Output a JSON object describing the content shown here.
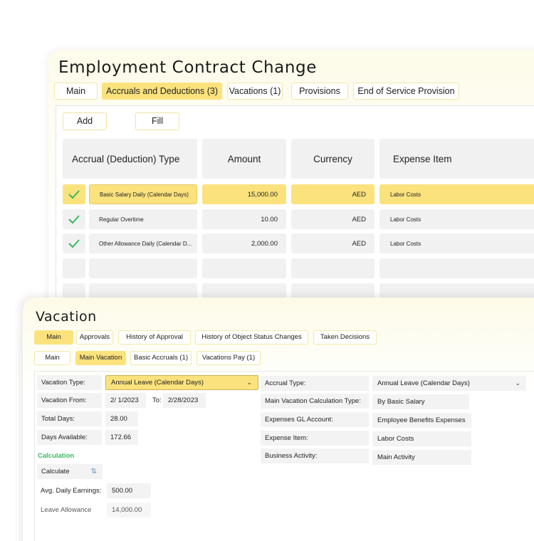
{
  "contract": {
    "title": "Employment Contract Change",
    "tabs": [
      {
        "label": "Main"
      },
      {
        "label": "Accruals and Deductions (3)",
        "active": true
      },
      {
        "label": "Vacations (1)"
      },
      {
        "label": "Provisions"
      },
      {
        "label": "End of Service Provision"
      }
    ],
    "toolbar": {
      "add_label": "Add",
      "fill_label": "Fill"
    },
    "table": {
      "headers": [
        "Accrual (Deduction) Type",
        "Amount",
        "Currency",
        "Expense Item"
      ],
      "rows": [
        {
          "checked": true,
          "type": "Basic Salary Daily (Calendar Days)",
          "amount": "15,000.00",
          "currency": "AED",
          "expense_item": "Labor Costs",
          "selected": true
        },
        {
          "checked": true,
          "type": "Regular Overtime",
          "amount": "10.00",
          "currency": "AED",
          "expense_item": "Labor Costs"
        },
        {
          "checked": true,
          "type": "Other Allowance Daily (Calendar D...",
          "amount": "2,000.00",
          "currency": "AED",
          "expense_item": "Labor Costs"
        }
      ]
    }
  },
  "vacation": {
    "title": "Vacation",
    "tabs": [
      {
        "label": "Main",
        "active": true
      },
      {
        "label": "Approvals"
      },
      {
        "label": "History of Approval"
      },
      {
        "label": "History of Object Status Changes"
      },
      {
        "label": "Taken Decisions"
      }
    ],
    "subtabs": [
      {
        "label": "Main"
      },
      {
        "label": "Main Vacation",
        "active": true
      },
      {
        "label": "Basic Accruals (1)"
      },
      {
        "label": "Vacations Pay (1)"
      }
    ],
    "left": {
      "vacation_type_label": "Vacation Type:",
      "vacation_type_value": "Annual Leave (Calendar Days)",
      "vacation_from_label": "Vacation From:",
      "vacation_from_value": "2/ 1/2023",
      "to_label": "To:",
      "to_value": "2/28/2023",
      "total_days_label": "Total Days:",
      "total_days_value": "28.00",
      "days_available_label": "Days Available:",
      "days_available_value": "172.66",
      "calculation_title": "Calculation",
      "calculate_label": "Calculate",
      "avg_daily_label": "Avg. Daily Earnings:",
      "avg_daily_value": "500.00",
      "leave_allowance_label": "Leave Allowance",
      "leave_allowance_value": "14,000.00"
    },
    "right": {
      "accrual_type_label": "Accrual Type:",
      "accrual_type_value": "Annual Leave (Calendar Days)",
      "calc_type_label": "Main Vacation Calculation Type:",
      "calc_type_value": "By Basic Salary",
      "gl_account_label": "Expenses GL Account:",
      "gl_account_value": "Employee Benefits Expenses",
      "expense_item_label": "Expense Item:",
      "expense_item_value": "Labor Costs",
      "business_activity_label": "Business Activity:",
      "business_activity_value": "Main Activity"
    }
  },
  "colors": {
    "accent": "#fbe27c",
    "check": "#3cb861",
    "calc_title": "#3cb861"
  }
}
